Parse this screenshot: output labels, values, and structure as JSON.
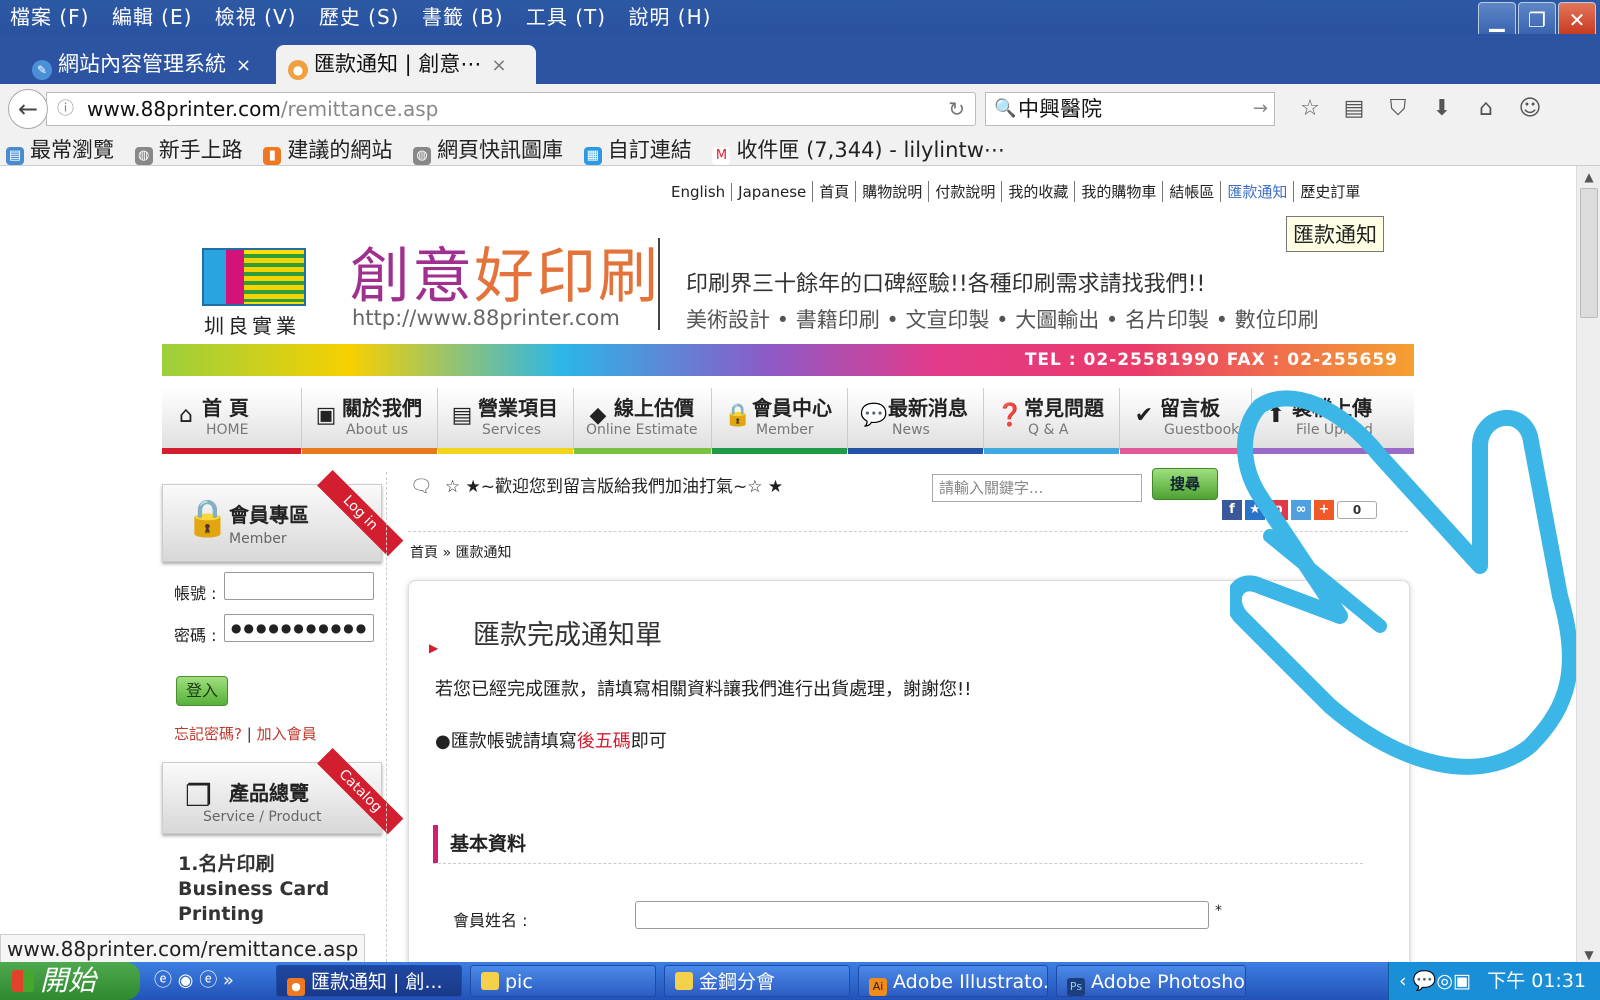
{
  "menubar": [
    "檔案 (F)",
    "編輯 (E)",
    "檢視 (V)",
    "歷史 (S)",
    "書籤 (B)",
    "工具 (T)",
    "說明 (H)"
  ],
  "tabs": [
    {
      "label": "網站內容管理系統",
      "active": false
    },
    {
      "label": "匯款通知 | 創意⋯",
      "active": true
    }
  ],
  "url": {
    "domain": "www.88printer.com",
    "path": "/remittance.asp"
  },
  "search": {
    "value": "中興醫院"
  },
  "bookmarks": [
    "最常瀏覽",
    "新手上路",
    "建議的網站",
    "網頁快訊圖庫",
    "自訂連結",
    "收件匣 (7,344) - lilylintw⋯"
  ],
  "topnav": [
    "English",
    "Japanese",
    "首頁",
    "購物說明",
    "付款說明",
    "我的收藏",
    "我的購物車",
    "結帳區",
    "匯款通知",
    "歷史訂單"
  ],
  "tooltip": "匯款通知",
  "header": {
    "logo_text": "圳良實業",
    "brand_a": "創意",
    "brand_b": "好印刷",
    "url": "http://www.88printer.com",
    "slogan1": "印刷界三十餘年的口碑經驗!!各種印刷需求請找我們!!",
    "slogan2": "美術設計 • 書籍印刷 • 文宣印製 • 大圖輸出 • 名片印製 • 數位印刷",
    "contact": "TEL : 02-25581990  FAX : 02-255659"
  },
  "mainnav": [
    {
      "zh": "首 頁",
      "en": "HOME",
      "color": "#d21e2e"
    },
    {
      "zh": "關於我們",
      "en": "About us",
      "color": "#e87a1d"
    },
    {
      "zh": "營業項目",
      "en": "Services",
      "color": "#f2d51a"
    },
    {
      "zh": "線上估價",
      "en": "Online Estimate",
      "color": "#7cc242"
    },
    {
      "zh": "會員中心",
      "en": "Member",
      "color": "#1f9a46"
    },
    {
      "zh": "最新消息",
      "en": "News",
      "color": "#2453a5"
    },
    {
      "zh": "常見問題",
      "en": "Q & A",
      "color": "#3fa9e0"
    },
    {
      "zh": "留言板",
      "en": "Guestbook",
      "color": "#e05a9a"
    },
    {
      "zh": "製檔上傳",
      "en": "File Upload",
      "color": "#9b6ac8"
    }
  ],
  "member": {
    "title": "會員專區",
    "subtitle": "Member",
    "ribbon": "Log in",
    "account_label": "帳號 :",
    "account_value": "",
    "password_label": "密碼 :",
    "password_value": "●●●●●●●●●●●",
    "login_label": "登入",
    "forgot": "忘記密碼?",
    "join": "加入會員"
  },
  "catalog": {
    "title": "產品總覽",
    "subtitle": "Service / Product",
    "ribbon": "Catalog",
    "item1_zh": "1.名片印刷",
    "item1_en": "Business Card",
    "item1_en2": "Printing"
  },
  "welcome": "☆ ★~歡迎您到留言版給我們加油打氣~☆ ★",
  "keyword_placeholder": "請輸入關鍵字...",
  "search_btn": "搜尋",
  "share_count": "0",
  "breadcrumb": "首頁 » 匯款通知",
  "panel": {
    "title": "匯款完成通知單",
    "line1": "若您已經完成匯款，請填寫相關資料讓我們進行出貨處理，謝謝您!!",
    "line2_a": "●匯款帳號請填寫",
    "line2_red": "後五碼",
    "line2_b": "即可",
    "section": "基本資料",
    "name_label": "會員姓名 :",
    "required_mark": "*"
  },
  "status_url": "www.88printer.com/remittance.asp",
  "taskbar": {
    "start": "開始",
    "items": [
      "匯款通知 | 創...",
      "pic",
      "金鋼分會",
      "Adobe Illustrato...",
      "Adobe Photosho..."
    ],
    "clock": "下午 01:31"
  },
  "colors": {
    "accent_blue": "#2c54a2",
    "brand_purple": "#a03090",
    "alert_red": "#d21e2e"
  }
}
